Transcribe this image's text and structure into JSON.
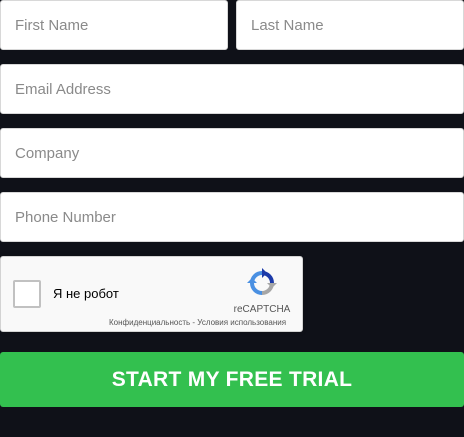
{
  "form": {
    "first_name": {
      "value": "",
      "placeholder": "First Name"
    },
    "last_name": {
      "value": "",
      "placeholder": "Last Name"
    },
    "email": {
      "value": "",
      "placeholder": "Email Address"
    },
    "company": {
      "value": "",
      "placeholder": "Company"
    },
    "phone": {
      "value": "",
      "placeholder": "Phone Number"
    }
  },
  "recaptcha": {
    "checkbox_label": "Я не робот",
    "brand": "reCAPTCHA",
    "privacy_link": "Конфиденциальность",
    "separator": " - ",
    "terms_link": "Условия использования",
    "checked": false
  },
  "submit": {
    "label": "START MY FREE TRIAL"
  },
  "colors": {
    "background": "#0f1118",
    "button": "#33c04f",
    "button_text": "#ffffff",
    "field_bg": "#ffffff",
    "placeholder": "#8a8a8a"
  },
  "icons": {
    "captcha_logo": "recaptcha-logo-icon"
  }
}
